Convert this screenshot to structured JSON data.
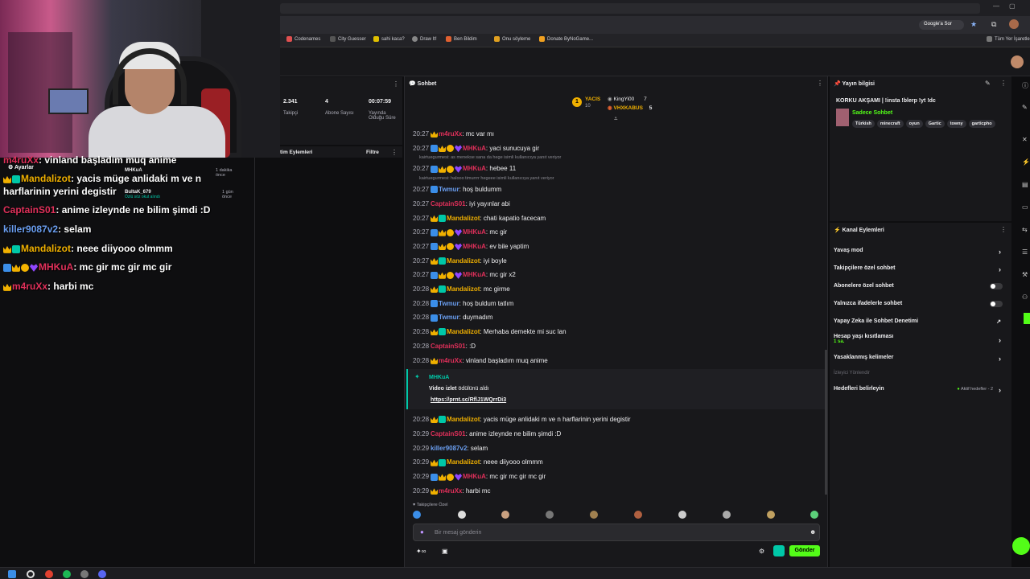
{
  "browser": {
    "bookmarks": [
      "Codenames",
      "City Guesser",
      "sahi kaca?",
      "Draw It!",
      "Ben Bildim",
      "Onu söyleme",
      "Donate ByNoGame..."
    ],
    "right_bookmark": "Tüm Yer İşaretle",
    "google_label": "Google'a Sor"
  },
  "overlay_chat": {
    "lines": [
      {
        "user": "m4ruXx",
        "text": "vinland başladım muq anime",
        "color": "#e0305a"
      },
      {
        "user": "Mandalizot",
        "text": "yacis müge anlidaki m ve n harflarinin yerini degistir",
        "color": "#f0b000"
      },
      {
        "user": "CaptainS01",
        "text": "anime izleynde ne bilim şimdi :D",
        "color": "#e0305a"
      },
      {
        "user": "killer9087v2",
        "text": "selam",
        "color": "#6a9ef0"
      },
      {
        "user": "Mandalizot",
        "text": "neee diiyooo olmmm",
        "color": "#f0b000"
      },
      {
        "user": "MHKuA",
        "text": "mc gir mc gir mc gir",
        "color": "#e0305a"
      },
      {
        "user": "m4ruXx",
        "text": "harbi mc",
        "color": "#e0305a"
      }
    ],
    "settings_label": "Ayarlar",
    "activity": [
      {
        "user": "MHKuA",
        "time": "1 dakika önce",
        "note": ""
      },
      {
        "user": "BultaK_679",
        "time": "1 gün önce",
        "note": "Özlü söz okut alındı"
      }
    ]
  },
  "stats": {
    "items": [
      {
        "value": "2.341",
        "label": "Takipçi"
      },
      {
        "value": "4",
        "label": "Abone Sayısı"
      },
      {
        "value": "00:07:59",
        "label": "Yayında Olduğu Süre"
      }
    ],
    "actions_title": "tim Eylemleri",
    "filter_label": "Filtre"
  },
  "chat": {
    "title": "Sohbet",
    "leaderboard": [
      {
        "name": "YACIS",
        "value": "10"
      },
      {
        "name": "KingYi00",
        "value": "7"
      },
      {
        "name": "VHXKABUS",
        "value": "5"
      }
    ],
    "messages": [
      {
        "ts": "20:27",
        "badges": [
          "crown"
        ],
        "user": "m4ruXx",
        "color": "#e0305a",
        "text": "mc var mı"
      },
      {
        "ts": "20:27",
        "badges": [
          "sword",
          "crown",
          "coin",
          "heart"
        ],
        "user": "MHKuA",
        "color": "#e0305a",
        "text": "yaci sunucuya gir"
      },
      {
        "sys": "kairtuegurmesi: as menekse sana da hege isimli kullanıcıya yanıt veriyor"
      },
      {
        "ts": "20:27",
        "badges": [
          "sword",
          "crown",
          "coin",
          "heart"
        ],
        "user": "MHKuA",
        "color": "#e0305a",
        "text": "hebee 11"
      },
      {
        "sys": "kairtuegurmesi: halooo timurrrr hegeee isimli kullanıcıya yanıt veriyor"
      },
      {
        "ts": "20:27",
        "badges": [
          "sword"
        ],
        "user": "Twmur",
        "color": "#6a9ef0",
        "text": "hoş buldumm"
      },
      {
        "ts": "20:27",
        "badges": [],
        "user": "CaptainS01",
        "color": "#e0305a",
        "text": "iyi yayınlar abi"
      },
      {
        "ts": "20:27",
        "badges": [
          "crown",
          "tier"
        ],
        "user": "Mandalizot",
        "color": "#f0b000",
        "text": "chati kapatio facecam"
      },
      {
        "ts": "20:27",
        "badges": [
          "sword",
          "crown",
          "coin",
          "heart"
        ],
        "user": "MHKuA",
        "color": "#e0305a",
        "text": "mc gir"
      },
      {
        "ts": "20:27",
        "badges": [
          "sword",
          "crown",
          "coin",
          "heart"
        ],
        "user": "MHKuA",
        "color": "#e0305a",
        "text": "ev bile yaptim"
      },
      {
        "ts": "20:27",
        "badges": [
          "crown",
          "tier"
        ],
        "user": "Mandalizot",
        "color": "#f0b000",
        "text": "iyi boyle"
      },
      {
        "ts": "20:27",
        "badges": [
          "sword",
          "crown",
          "coin",
          "heart"
        ],
        "user": "MHKuA",
        "color": "#e0305a",
        "text": "mc gir x2"
      },
      {
        "ts": "20:28",
        "badges": [
          "crown",
          "tier"
        ],
        "user": "Mandalizot",
        "color": "#f0b000",
        "text": "mc girme"
      },
      {
        "ts": "20:28",
        "badges": [
          "sword"
        ],
        "user": "Twmur",
        "color": "#6a9ef0",
        "text": "hoş buldum tatlım"
      },
      {
        "ts": "20:28",
        "badges": [
          "sword"
        ],
        "user": "Twmur",
        "color": "#6a9ef0",
        "text": "duymadım"
      },
      {
        "ts": "20:28",
        "badges": [
          "crown",
          "tier"
        ],
        "user": "Mandalizot",
        "color": "#f0b000",
        "text": "Merhaba demekte mi suc lan"
      },
      {
        "ts": "20:28",
        "badges": [],
        "user": "CaptainS01",
        "color": "#e0305a",
        "text": ":D"
      },
      {
        "ts": "20:28",
        "badges": [
          "crown"
        ],
        "user": "m4ruXx",
        "color": "#e0305a",
        "text": "vinland başladım muq anime"
      }
    ],
    "redemption": {
      "user": "MHKuA",
      "title": "Video izlet",
      "suffix": "ödülünü aldı",
      "link": "https://prnt.sc/RflJ1WQrrDi3"
    },
    "messages2": [
      {
        "ts": "20:28",
        "badges": [
          "crown",
          "tier"
        ],
        "user": "Mandalizot",
        "color": "#f0b000",
        "text": "yacis müge anlidaki m ve n harflarinin yerini degistir"
      },
      {
        "ts": "20:29",
        "badges": [],
        "user": "CaptainS01",
        "color": "#e0305a",
        "text": "anime izleynde ne bilim şimdi :D"
      },
      {
        "ts": "20:29",
        "badges": [],
        "user": "killer9087v2",
        "color": "#6a9ef0",
        "text": "selam"
      },
      {
        "ts": "20:29",
        "badges": [
          "crown",
          "tier"
        ],
        "user": "Mandalizot",
        "color": "#f0b000",
        "text": "neee diiyooo olmmm"
      },
      {
        "ts": "20:29",
        "badges": [
          "sword",
          "crown",
          "coin",
          "heart"
        ],
        "user": "MHKuA",
        "color": "#e0305a",
        "text": "mc gir mc gir mc gir"
      },
      {
        "ts": "20:29",
        "badges": [
          "crown"
        ],
        "user": "m4ruXx",
        "color": "#e0305a",
        "text": "harbi mc"
      }
    ],
    "followers_only": "Takipçilere Özel",
    "input_placeholder": "Bir mesaj gönderin",
    "send_label": "Gönder",
    "points": "∞"
  },
  "stream_info": {
    "title": "Yayın bilgisi",
    "stream_title": "KORKU AKŞAMI | !insta !blerp !yt !dc",
    "category": "Sadece Sohbet",
    "tags": [
      "Türkish",
      "minecraft",
      "oyun",
      "Gartic",
      "towny",
      "garticpho"
    ]
  },
  "channel_actions": {
    "title": "Kanal Eylemleri",
    "rows": [
      {
        "label": "Yavaş mod",
        "control": "chevron"
      },
      {
        "label": "Takipçilere özel sohbet",
        "control": "chevron"
      },
      {
        "label": "Abonelere özel sohbet",
        "control": "toggle"
      },
      {
        "label": "Yalnızca ifadelerle sohbet",
        "control": "toggle"
      },
      {
        "label": "Yapay Zeka ile Sohbet Denetimi",
        "control": "external"
      },
      {
        "label": "Hesap yaşı kısıtlaması",
        "control": "chevron",
        "sub": "1 sa."
      },
      {
        "label": "Yasaklanmış kelimeler",
        "control": "chevron"
      }
    ],
    "section": "İzleyici Yönlendir",
    "goals_label": "Hedefleri belirleyin",
    "goals_status": "Aktif hedefler - 2"
  }
}
